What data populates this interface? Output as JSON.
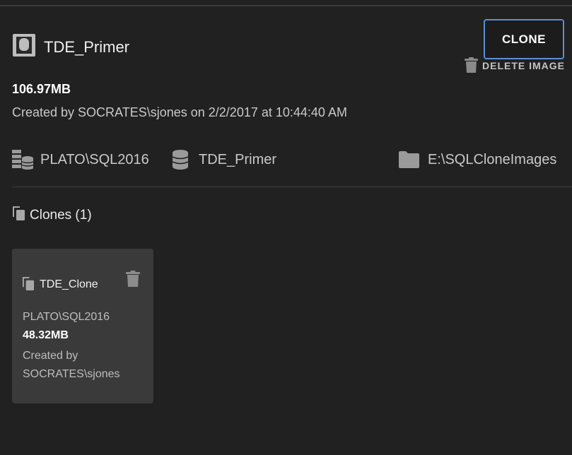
{
  "image": {
    "icon": "database-image-icon",
    "title": "TDE_Primer",
    "size": "106.97MB",
    "created": "Created by SOCRATES\\sjones on 2/2/2017 at 10:44:40 AM"
  },
  "actions": {
    "clone_label": "CLONE",
    "delete_label": "DELETE IMAGE",
    "accent_color": "#5b8fd6"
  },
  "location": {
    "server": {
      "icon": "server-database-icon",
      "label": "PLATO\\SQL2016"
    },
    "database": {
      "icon": "database-icon",
      "label": "TDE_Primer"
    },
    "folder": {
      "icon": "folder-icon",
      "label": "E:\\SQLCloneImages"
    }
  },
  "clones": {
    "icon": "copy-icon",
    "heading": "Clones (1)",
    "items": [
      {
        "name": "TDE_Clone",
        "server": "PLATO\\SQL2016",
        "size": "48.32MB",
        "created": "Created by SOCRATES\\sjones"
      }
    ]
  }
}
